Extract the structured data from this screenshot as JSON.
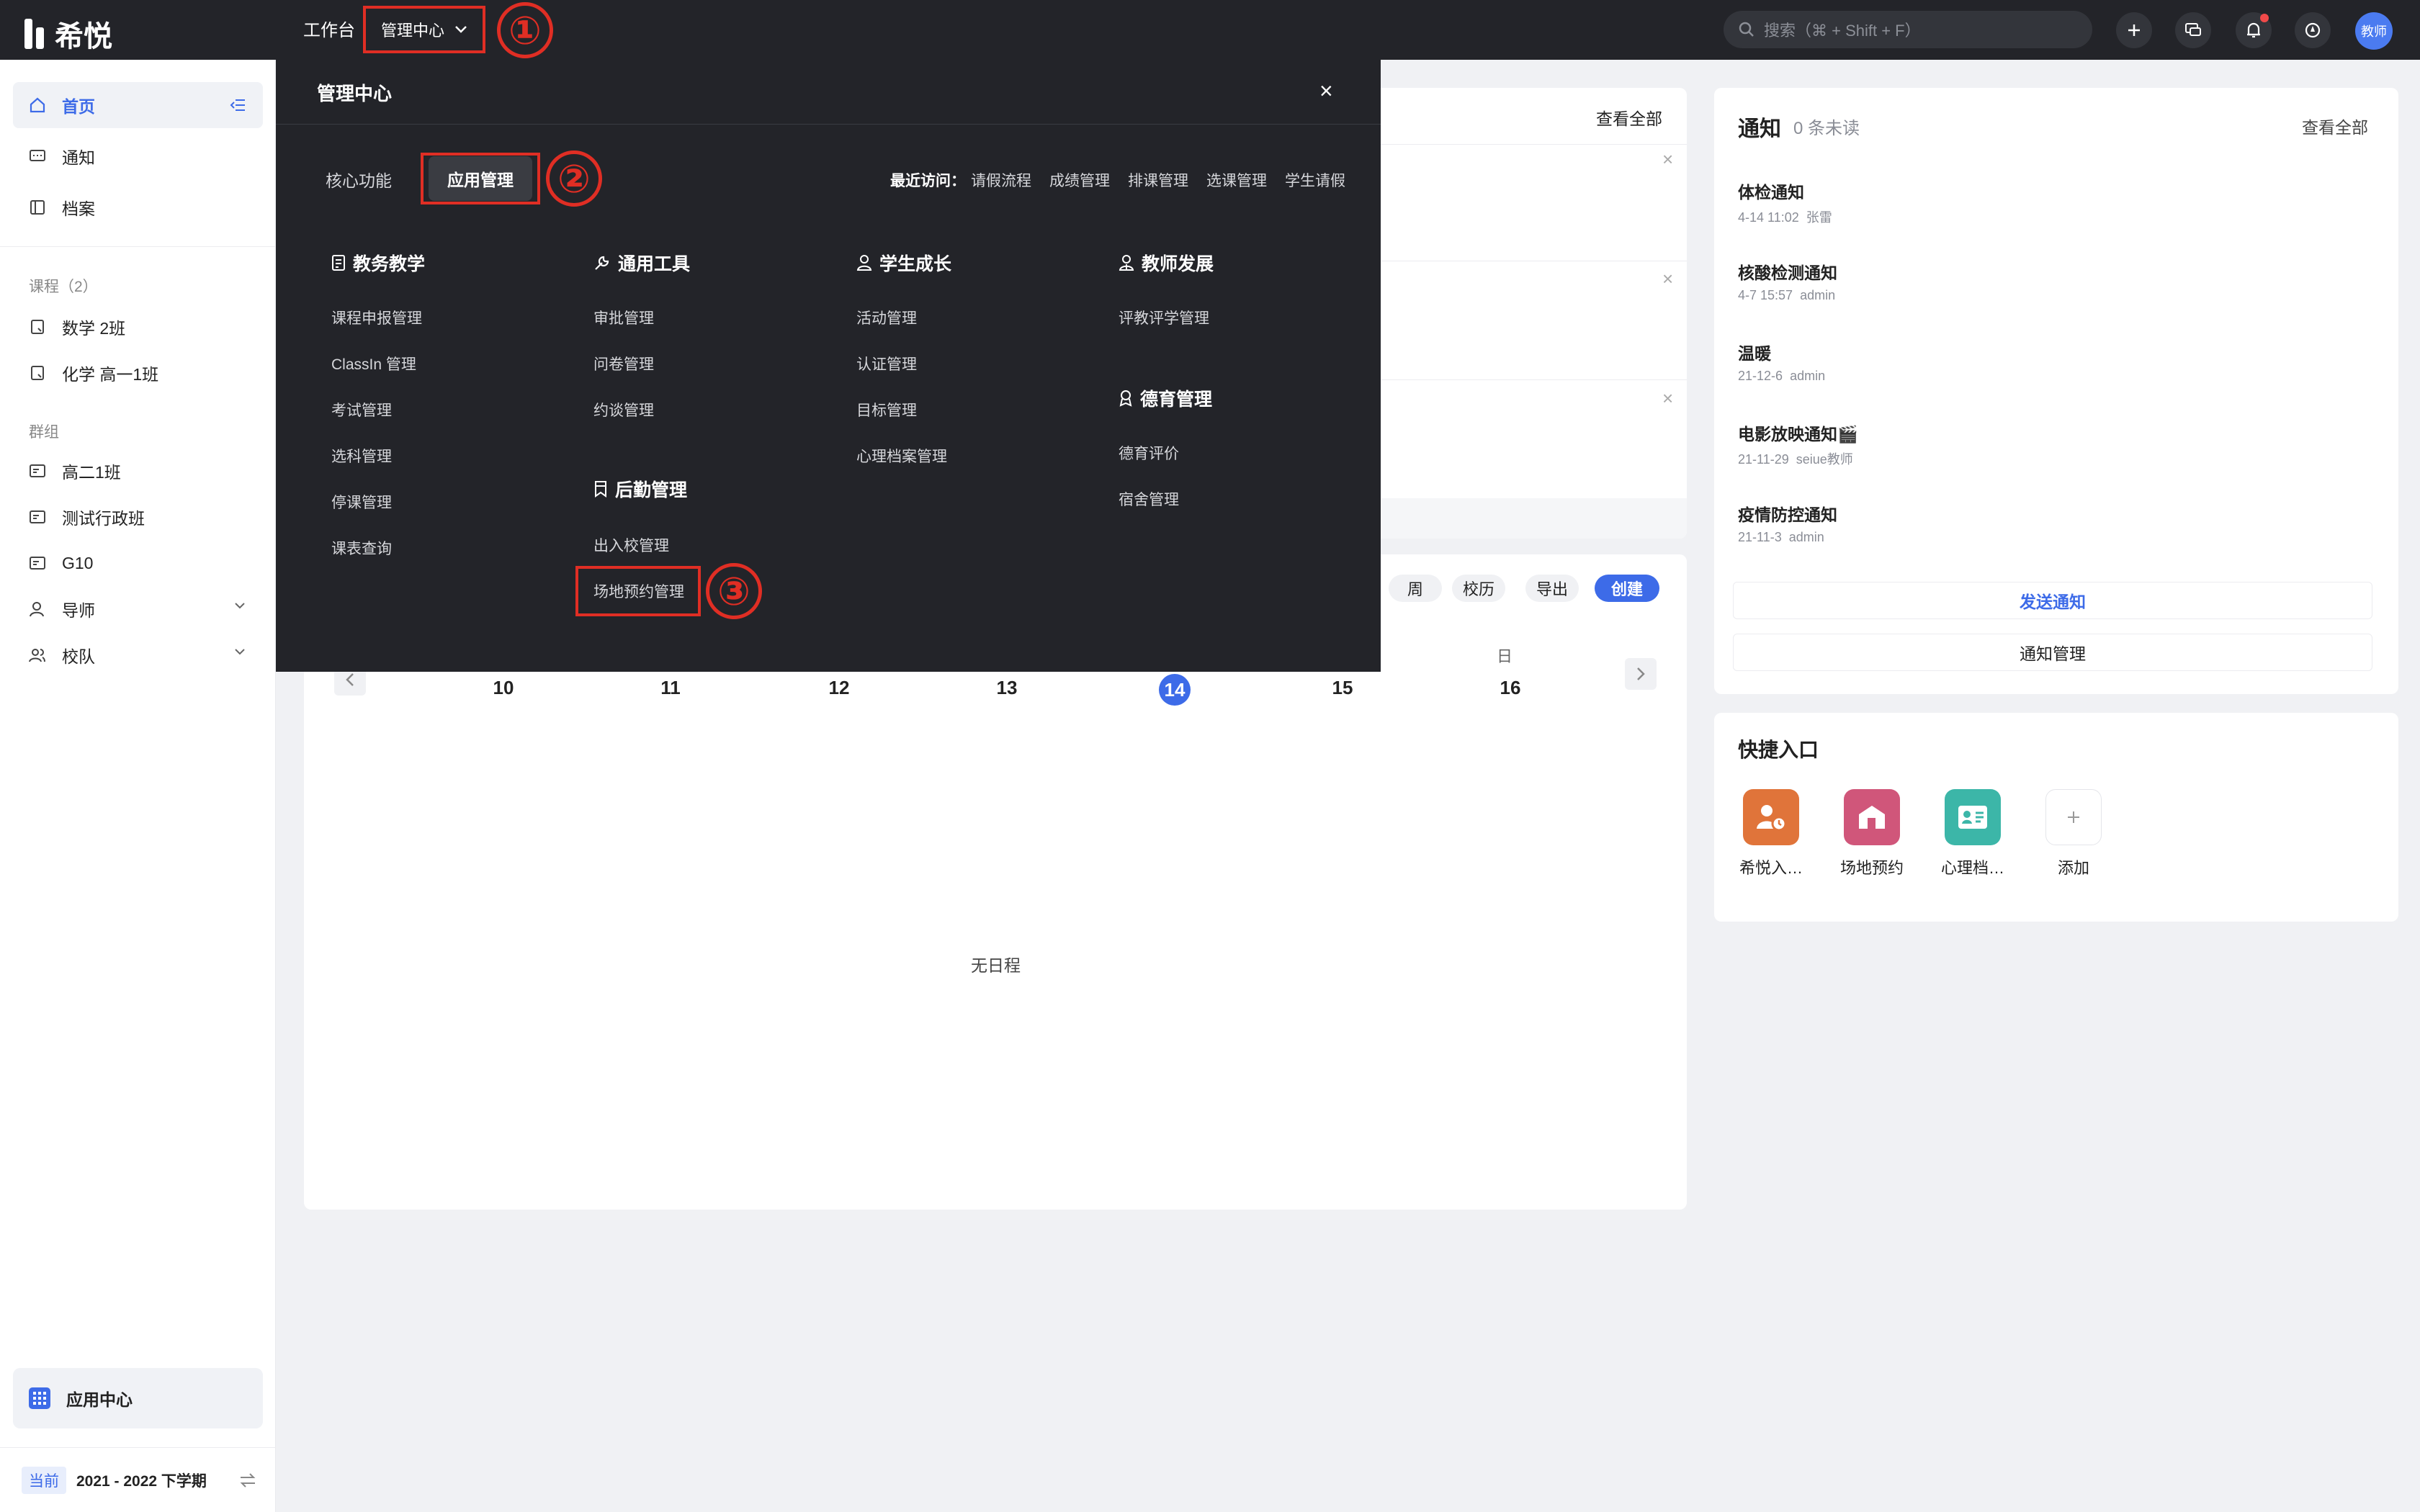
{
  "topbar": {
    "logo_text": "希悦",
    "workbench": "工作台",
    "mgmt_center": "管理中心",
    "search_placeholder": "搜索（⌘ + Shift + F）",
    "avatar_text": "教师",
    "step1": "①",
    "step2": "②",
    "step3": "③"
  },
  "sidebar": {
    "items": [
      {
        "label": "首页"
      },
      {
        "label": "通知"
      },
      {
        "label": "档案"
      }
    ],
    "courses_header": "课程（2）",
    "courses": [
      {
        "label": "数学 2班"
      },
      {
        "label": "化学 高一1班"
      }
    ],
    "groups_header": "群组",
    "groups": [
      {
        "label": "高二1班"
      },
      {
        "label": "测试行政班"
      },
      {
        "label": "G10"
      },
      {
        "label": "导师"
      },
      {
        "label": "校队"
      }
    ],
    "app_center": "应用中心",
    "term_badge": "当前",
    "term_label": "2021 - 2022 下学期"
  },
  "main": {
    "view_all": "查看全部",
    "cal_buttons": [
      "周",
      "校历",
      "导出",
      "创建"
    ],
    "weekday_sun": "日",
    "days": [
      "10",
      "11",
      "12",
      "13",
      "14",
      "15",
      "16"
    ],
    "no_schedule": "无日程"
  },
  "notifications": {
    "title": "通知",
    "unread": "0 条未读",
    "view_all": "查看全部",
    "items": [
      {
        "title": "体检通知",
        "time": "4-14 11:02",
        "author": "张雷"
      },
      {
        "title": "核酸检测通知",
        "time": "4-7 15:57",
        "author": "admin"
      },
      {
        "title": "温暖",
        "time": "21-12-6",
        "author": "admin"
      },
      {
        "title": "电影放映通知🎬",
        "time": "21-11-29",
        "author": "seiue教师"
      },
      {
        "title": "疫情防控通知",
        "time": "21-11-3",
        "author": "admin"
      }
    ],
    "send_btn": "发送通知",
    "manage_btn": "通知管理"
  },
  "quick": {
    "title": "快捷入口",
    "items": [
      {
        "label": "希悦入…",
        "color": "#e0743a"
      },
      {
        "label": "场地预约",
        "color": "#d0567a"
      },
      {
        "label": "心理档…",
        "color": "#3cb6a8"
      },
      {
        "label": "添加",
        "color": "#ffffff"
      }
    ]
  },
  "overlay": {
    "title": "管理中心",
    "tabs": [
      "核心功能",
      "应用管理"
    ],
    "recent_label": "最近访问：",
    "recent": [
      "请假流程",
      "成绩管理",
      "排课管理",
      "选课管理",
      "学生请假"
    ],
    "categories": [
      {
        "title": "教务教学",
        "links": [
          "课程申报管理",
          "ClassIn 管理",
          "考试管理",
          "选科管理",
          "停课管理",
          "课表查询"
        ]
      },
      {
        "title": "通用工具",
        "links": [
          "审批管理",
          "问卷管理",
          "约谈管理"
        ]
      },
      {
        "title": "后勤管理",
        "links": [
          "出入校管理",
          "场地预约管理"
        ]
      },
      {
        "title": "学生成长",
        "links": [
          "活动管理",
          "认证管理",
          "目标管理",
          "心理档案管理"
        ]
      },
      {
        "title": "教师发展",
        "links": [
          "评教评学管理"
        ]
      },
      {
        "title": "德育管理",
        "links": [
          "德育评价",
          "宿舍管理"
        ]
      }
    ]
  }
}
